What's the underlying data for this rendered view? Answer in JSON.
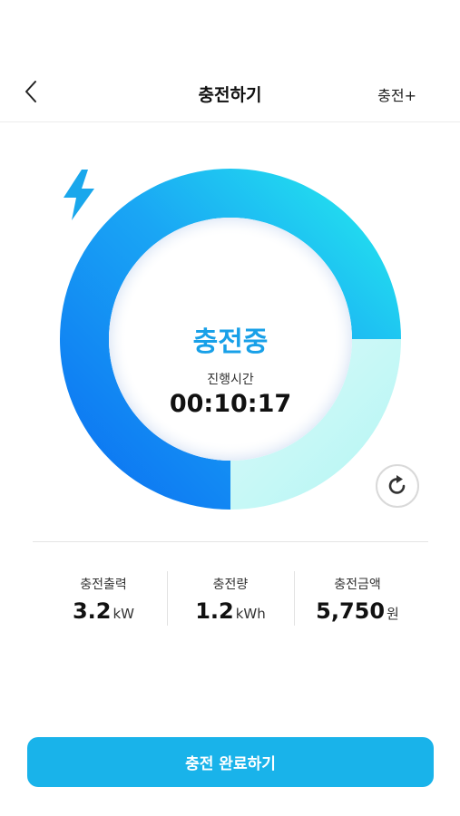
{
  "header": {
    "title": "충전하기",
    "action_label": "충전+"
  },
  "gauge": {
    "status": "충전중",
    "elapsed_label": "진행시간",
    "elapsed_value": "00:10:17",
    "progress_fraction": 0.75
  },
  "stats": [
    {
      "label": "충전출력",
      "value": "3.2",
      "unit": "kW"
    },
    {
      "label": "충전량",
      "value": "1.2",
      "unit": "kWh"
    },
    {
      "label": "충전금액",
      "value": "5,750",
      "unit": "원"
    }
  ],
  "complete_button_label": "충전 완료하기",
  "colors": {
    "accent": "#19b3ea",
    "gradient_start": "#0a6cf2",
    "gradient_end": "#25f0ee"
  },
  "icons": {
    "back": "chevron-left-icon",
    "status": "lightning-bolt-icon",
    "refresh": "refresh-icon"
  }
}
